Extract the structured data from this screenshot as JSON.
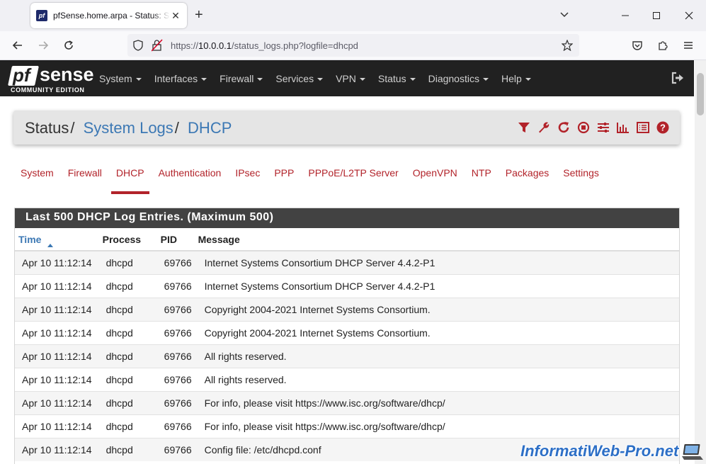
{
  "browser": {
    "tab_title": "pfSense.home.arpa - Status: System Logs: DHCP",
    "favicon_text": "pf",
    "url_prefix": "https://",
    "url_host": "10.0.0.1",
    "url_path": "/status_logs.php?logfile=dhcpd"
  },
  "pf": {
    "logo_pf": "pf",
    "logo_sense": "sense",
    "logo_sub": "COMMUNITY EDITION",
    "menu": [
      "System",
      "Interfaces",
      "Firewall",
      "Services",
      "VPN",
      "Status",
      "Diagnostics",
      "Help"
    ]
  },
  "breadcrumb": {
    "first": "Status",
    "second": "System Logs",
    "third": "DHCP",
    "sep": "/"
  },
  "tabs": [
    "System",
    "Firewall",
    "DHCP",
    "Authentication",
    "IPsec",
    "PPP",
    "PPPoE/L2TP Server",
    "OpenVPN",
    "NTP",
    "Packages",
    "Settings"
  ],
  "active_tab": "DHCP",
  "log": {
    "heading": "Last 500 DHCP Log Entries. (Maximum 500)",
    "columns": [
      "Time",
      "Process",
      "PID",
      "Message"
    ],
    "rows": [
      {
        "time": "Apr 10 11:12:14",
        "process": "dhcpd",
        "pid": "69766",
        "message": "Internet Systems Consortium DHCP Server 4.4.2-P1"
      },
      {
        "time": "Apr 10 11:12:14",
        "process": "dhcpd",
        "pid": "69766",
        "message": "Internet Systems Consortium DHCP Server 4.4.2-P1"
      },
      {
        "time": "Apr 10 11:12:14",
        "process": "dhcpd",
        "pid": "69766",
        "message": "Copyright 2004-2021 Internet Systems Consortium."
      },
      {
        "time": "Apr 10 11:12:14",
        "process": "dhcpd",
        "pid": "69766",
        "message": "Copyright 2004-2021 Internet Systems Consortium."
      },
      {
        "time": "Apr 10 11:12:14",
        "process": "dhcpd",
        "pid": "69766",
        "message": "All rights reserved."
      },
      {
        "time": "Apr 10 11:12:14",
        "process": "dhcpd",
        "pid": "69766",
        "message": "All rights reserved."
      },
      {
        "time": "Apr 10 11:12:14",
        "process": "dhcpd",
        "pid": "69766",
        "message": "For info, please visit https://www.isc.org/software/dhcp/"
      },
      {
        "time": "Apr 10 11:12:14",
        "process": "dhcpd",
        "pid": "69766",
        "message": "For info, please visit https://www.isc.org/software/dhcp/"
      },
      {
        "time": "Apr 10 11:12:14",
        "process": "dhcpd",
        "pid": "69766",
        "message": "Config file: /etc/dhcpd.conf"
      }
    ]
  },
  "watermark": "InformatiWeb-Pro.net",
  "colors": {
    "accent_red": "#b2232a",
    "link_blue": "#3c78b4",
    "navbar_dark": "#212121",
    "panel_header": "#424242"
  },
  "icons": {
    "breadcrumb_actions": [
      "filter-icon",
      "wrench-icon",
      "refresh-icon",
      "stop-circle-icon",
      "sliders-icon",
      "bar-chart-icon",
      "list-icon",
      "help-icon"
    ]
  }
}
